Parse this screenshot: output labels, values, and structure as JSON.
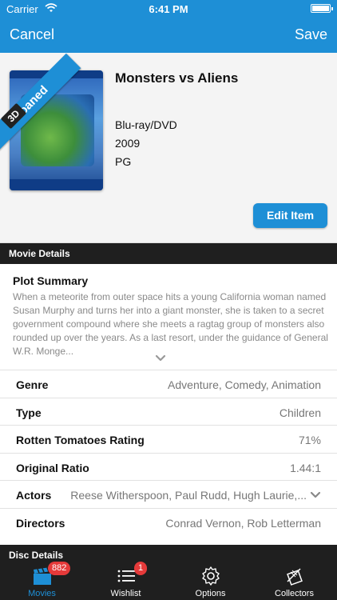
{
  "status": {
    "carrier": "Carrier",
    "time": "6:41 PM"
  },
  "nav": {
    "cancel": "Cancel",
    "save": "Save"
  },
  "movie": {
    "ribbon": "Loaned",
    "badge": "3D",
    "title": "Monsters vs Aliens",
    "format": "Blu-ray/DVD",
    "year": "2009",
    "rating": "PG",
    "edit_label": "Edit Item"
  },
  "section_movie": "Movie Details",
  "plot": {
    "title": "Plot Summary",
    "text": "When a meteorite from outer space hits a young California woman named Susan Murphy and turns her into a giant monster, she is taken to a secret government compound where she meets a ragtag group of monsters also rounded up over the years. As a last resort, under the guidance of General W.R. Monge..."
  },
  "details": [
    {
      "label": "Genre",
      "value": "Adventure, Comedy, Animation"
    },
    {
      "label": "Type",
      "value": "Children"
    },
    {
      "label": "Rotten Tomatoes Rating",
      "value": "71%"
    },
    {
      "label": "Original Ratio",
      "value": "1.44:1"
    },
    {
      "label": "Actors",
      "value": "Reese Witherspoon, Paul Rudd, Hugh Laurie,..."
    },
    {
      "label": "Directors",
      "value": "Conrad Vernon, Rob Letterman"
    }
  ],
  "section_disc": "Disc Details",
  "tabs": [
    {
      "label": "Movies",
      "count": "882",
      "icon": "clapperboard-icon"
    },
    {
      "label": "Wishlist",
      "count": "1",
      "icon": "list-icon"
    },
    {
      "label": "Options",
      "icon": "gear-icon"
    },
    {
      "label": "Collectors",
      "icon": "collectors-icon"
    }
  ],
  "colors": {
    "accent": "#1e8fd6",
    "dark": "#1f1f1f",
    "badge": "#e53a3a"
  }
}
